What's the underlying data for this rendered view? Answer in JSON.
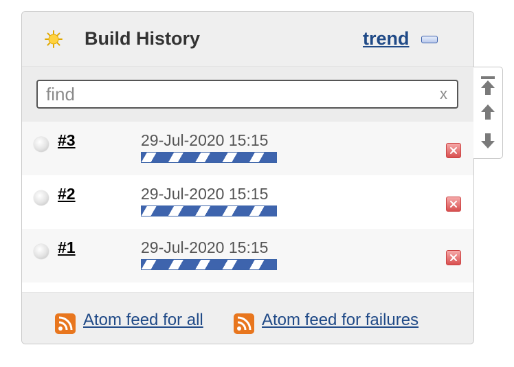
{
  "widget": {
    "title": "Build History",
    "trend_label": "trend"
  },
  "search": {
    "placeholder": "find",
    "value": "",
    "clear_label": "x"
  },
  "builds": [
    {
      "number": "#3",
      "date": "29-Jul-2020 15:15",
      "status": "not-built"
    },
    {
      "number": "#2",
      "date": "29-Jul-2020 15:15",
      "status": "not-built"
    },
    {
      "number": "#1",
      "date": "29-Jul-2020 15:15",
      "status": "not-built"
    }
  ],
  "feeds": {
    "all_label": "Atom feed for all",
    "failures_label": "Atom feed for failures"
  },
  "icons": {
    "header": "sun-icon",
    "collapse": "collapse-icon",
    "nav": [
      "scroll-top-icon",
      "scroll-up-icon",
      "scroll-down-icon"
    ],
    "feed": "rss-icon",
    "delete": "delete-icon"
  },
  "colors": {
    "link": "#204a87",
    "progress": "#3e64ad",
    "delete": "#d84f4f",
    "rss": "#e36e16"
  }
}
